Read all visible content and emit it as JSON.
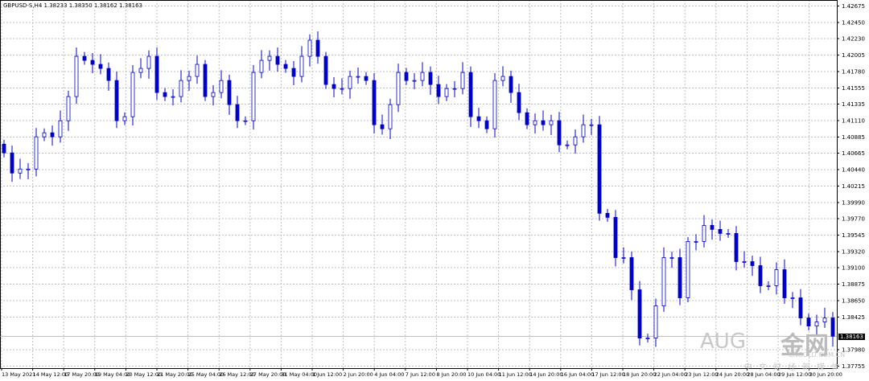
{
  "title": "GBPUSD-S,H4  1.38233 1.38350 1.38162 1.38163",
  "current_price": "1.38163",
  "colors": {
    "candle": "#0000cc",
    "grid": "#c0c0c0",
    "axis": "#000000"
  },
  "price_axis": [
    "1.42675",
    "1.42450",
    "1.42230",
    "1.42005",
    "1.41780",
    "1.41555",
    "1.41335",
    "1.41110",
    "1.40885",
    "1.40665",
    "1.40440",
    "1.40215",
    "1.39990",
    "1.39770",
    "1.39545",
    "1.39320",
    "1.39100",
    "1.38875",
    "1.38650",
    "1.38425",
    "1.37980",
    "1.37755"
  ],
  "time_axis": [
    "13 May 2021",
    "14 May 12:00",
    "17 May 20:00",
    "19 May 04:00",
    "20 May 12:00",
    "21 May 20:00",
    "25 May 04:00",
    "26 May 12:00",
    "27 May 20:00",
    "31 May 04:00",
    "1 Jun 12:00",
    "2 Jun 20:00",
    "4 Jun 04:00",
    "7 Jun 12:00",
    "8 Jun 20:00",
    "10 Jun 04:00",
    "11 Jun 12:00",
    "14 Jun 20:00",
    "16 Jun 04:00",
    "17 Jun 12:00",
    "18 Jun 20:00",
    "22 Jun 04:00",
    "23 Jun 12:00",
    "24 Jun 20:00",
    "28 Jun 04:00",
    "29 Jun 12:00",
    "30 Jun 20:00"
  ],
  "closes": [
    1.40668,
    1.40393,
    1.40448,
    1.40448,
    1.40888,
    1.40943,
    1.40888,
    1.41108,
    1.41438,
    1.41988,
    1.41933,
    1.41878,
    1.41823,
    1.41658,
    1.41108,
    1.41163,
    1.41768,
    1.41823,
    1.41988,
    1.41493,
    1.41438,
    1.41438,
    1.41658,
    1.41713,
    1.41878,
    1.41438,
    1.41493,
    1.41658,
    1.41328,
    1.41108,
    1.41108,
    1.41768,
    1.41933,
    1.41988,
    1.41878,
    1.41823,
    1.41713,
    1.41988,
    1.42208,
    1.41988,
    1.41603,
    1.41548,
    1.41548,
    1.41713,
    1.41713,
    1.41658,
    1.41053,
    1.40998,
    1.41328,
    1.41768,
    1.41658,
    1.41658,
    1.41768,
    1.41603,
    1.41438,
    1.41548,
    1.41548,
    1.41768,
    1.41163,
    1.41108,
    1.40998,
    1.41658,
    1.41713,
    1.41493,
    1.41218,
    1.41053,
    1.41108,
    1.41053,
    1.41108,
    1.40778,
    1.40778,
    1.40888,
    1.41053,
    1.41053,
    1.39843,
    1.39788,
    1.39238,
    1.39238,
    1.38798,
    1.38138,
    1.38138,
    1.38578,
    1.39238,
    1.39238,
    1.38688,
    1.39458,
    1.39458,
    1.39678,
    1.39623,
    1.39568,
    1.39568,
    1.39183,
    1.39183,
    1.39128,
    1.38853,
    1.38853,
    1.39073,
    1.38688,
    1.38688,
    1.38413,
    1.38303,
    1.38358,
    1.38413,
    1.38163
  ],
  "watermark": {
    "brand": "AUG",
    "logo": "金网",
    "site": "CNGOLD.COM.CN",
    "tagline": "中文财经新媒体"
  }
}
